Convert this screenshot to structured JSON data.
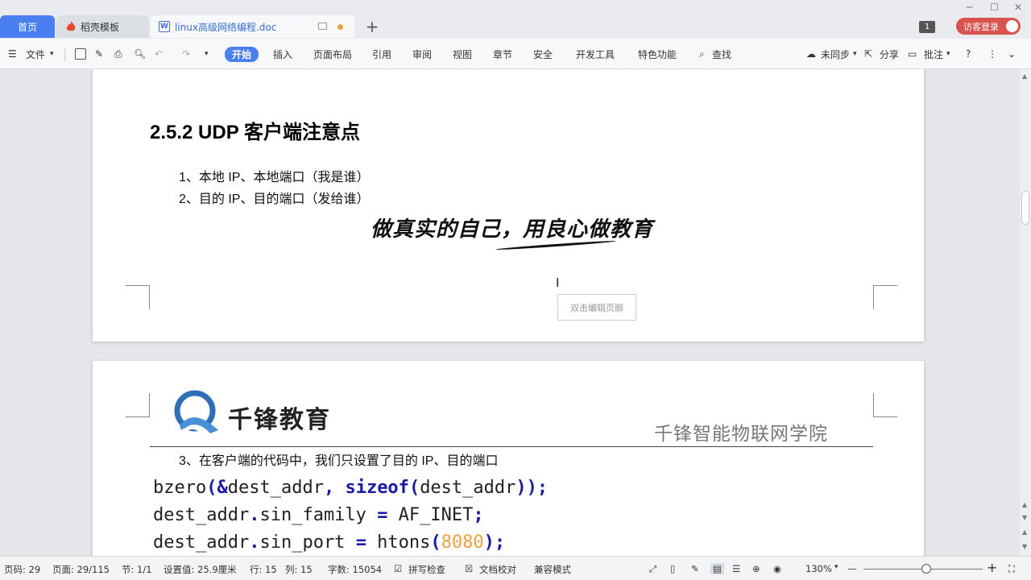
{
  "tabs": {
    "home": "首页",
    "daoke": "稻壳模板",
    "doc": "linux高级网络编程.doc",
    "add": "+"
  },
  "window": {
    "page_badge": "1",
    "login": "访客登录"
  },
  "toolbar": {
    "file": "文件",
    "start": "开始",
    "insert": "插入",
    "layout": "页面布局",
    "reference": "引用",
    "review": "审阅",
    "view": "视图",
    "chapter": "章节",
    "security": "安全",
    "devtools": "开发工具",
    "special": "特色功能",
    "search": "查找",
    "sync": "未同步",
    "share": "分享",
    "comment": "批注"
  },
  "doc": {
    "heading": "2.5.2 UDP 客户端注意点",
    "item1": "1、本地 IP、本地端口（我是谁）",
    "item2": "2、目的 IP、目的端口（发给谁）",
    "motto": "做真实的自己，用良心做教育",
    "footer_hint": "双击编辑页脚",
    "logo_text": "千锋教育",
    "school": "千锋智能物联网学院",
    "item3": "3、在客户端的代码中，我们只设置了目的 IP、目的端口",
    "code": {
      "l1_a": "bzero",
      "l1_b": "(&",
      "l1_c": "dest_addr",
      "l1_d": ", ",
      "l1_e": "sizeof",
      "l1_f": "(",
      "l1_g": "dest_addr",
      "l1_h": "));",
      "l2_a": "dest_addr",
      "l2_b": ".",
      "l2_c": "sin_family ",
      "l2_d": "=",
      "l2_e": " AF_INET",
      "l2_f": ";",
      "l3_a": "dest_addr",
      "l3_b": ".",
      "l3_c": "sin_port ",
      "l3_d": "=",
      "l3_e": " htons",
      "l3_f": "(",
      "l3_g": "8080",
      "l3_h": ");"
    }
  },
  "status": {
    "page_code": "页码: 29",
    "pages": "页面: 29/115",
    "section": "节: 1/1",
    "setting": "设置值: 25.9厘米",
    "row": "行: 15",
    "col": "列: 15",
    "words": "字数: 15054",
    "spell": "拼写检查",
    "proof": "文档校对",
    "compat": "兼容模式",
    "zoom": "130%",
    "minus": "—",
    "plus": "+"
  },
  "colors": {
    "accent": "#4a7ff2",
    "login": "#d9534f",
    "keyword": "#1a1aa6",
    "number": "#f0a042"
  }
}
